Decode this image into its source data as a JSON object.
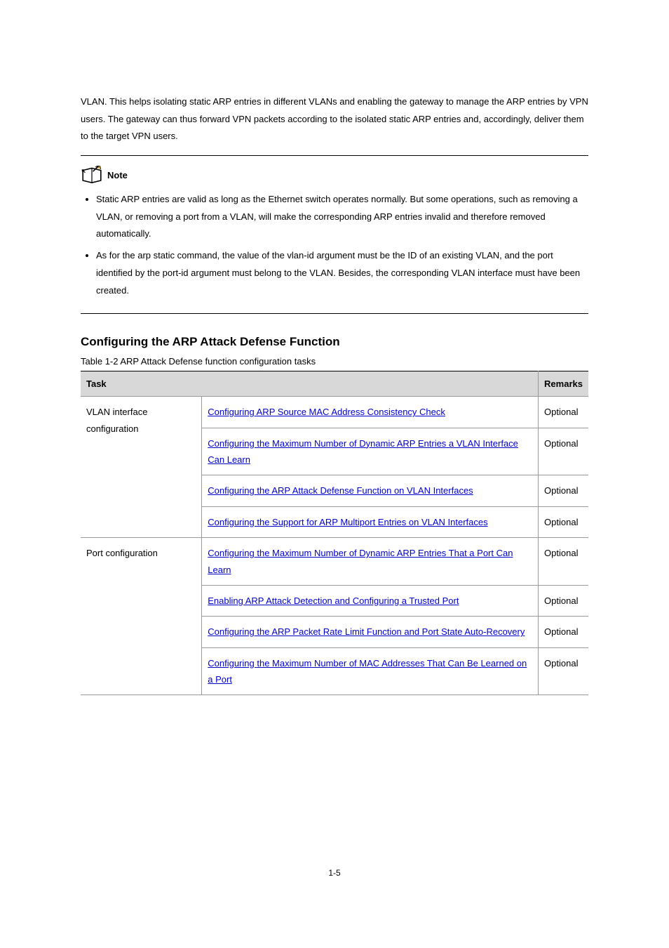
{
  "page": {
    "number": "1-5"
  },
  "intro_para": "VLAN. This helps isolating static ARP entries in different VLANs and enabling the gateway to manage the ARP entries by VPN users. The gateway can thus forward VPN packets according to the isolated static ARP entries and, accordingly, deliver them to the target VPN users.",
  "note": {
    "label": "Note",
    "items": [
      "Static ARP entries are valid as long as the Ethernet switch operates normally. But some operations, such as removing a VLAN, or removing a port from a VLAN, will make the corresponding ARP entries invalid and therefore removed automatically.",
      "As for the arp static command, the value of the vlan-id argument must be the ID of an existing VLAN, and the port identified by the port-id argument must belong to the VLAN. Besides, the corresponding VLAN interface must have been created."
    ]
  },
  "heading": "Configuring the ARP Attack Defense Function",
  "table": {
    "caption": "Table 1-2 ARP Attack Defense function configuration tasks",
    "headers": {
      "task": "Task",
      "remarks": "Remarks"
    },
    "groups": [
      {
        "name": "VLAN interface configuration",
        "rows": [
          {
            "desc_link": "Configuring ARP Source MAC Address Consistency Check",
            "desc_plain": "",
            "remarks": "Optional"
          },
          {
            "desc_link": "Configuring the Maximum Number of Dynamic ARP Entries a VLAN Interface Can Learn",
            "desc_plain": "",
            "remarks": "Optional"
          },
          {
            "desc_link": "Configuring the ARP Attack Defense Function on VLAN Interfaces",
            "desc_plain": "",
            "remarks": "Optional"
          },
          {
            "desc_link": "Configuring the Support for ARP Multiport Entries on VLAN Interfaces",
            "desc_plain": "",
            "remarks": "Optional"
          }
        ]
      },
      {
        "name": "Port configuration",
        "rows": [
          {
            "desc_link": "Configuring the Maximum Number of Dynamic ARP Entries That a Port Can Learn",
            "desc_plain": "",
            "remarks": "Optional"
          },
          {
            "desc_link": "Enabling ARP Attack Detection and Configuring a Trusted Port",
            "desc_plain": "",
            "remarks": "Optional"
          },
          {
            "desc_link": "Configuring the ARP Packet Rate Limit Function and Port State Auto-Recovery",
            "desc_plain": "",
            "remarks": "Optional"
          },
          {
            "desc_link": "Configuring the Maximum Number of MAC Addresses That Can Be Learned on a Port",
            "desc_plain": "",
            "remarks": "Optional"
          }
        ]
      }
    ]
  }
}
